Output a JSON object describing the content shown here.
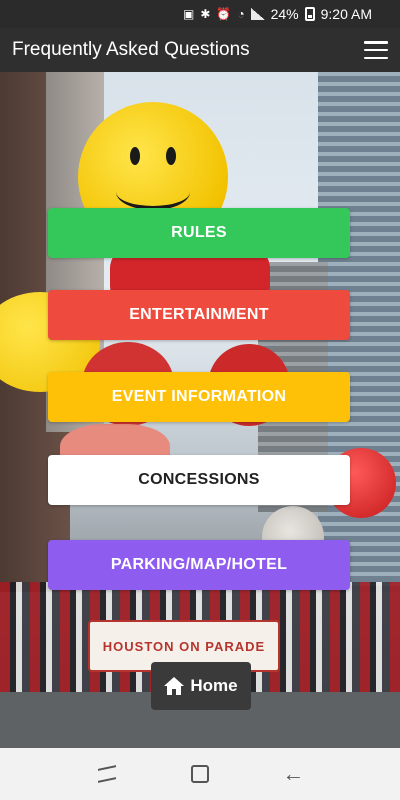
{
  "status_bar": {
    "battery": "24%",
    "time": "9:20 AM",
    "icons": [
      "image-icon",
      "bluetooth-icon",
      "alarm-icon",
      "wifi-icon",
      "signal-icon",
      "battery-icon"
    ]
  },
  "app_bar": {
    "title": "Frequently Asked Questions",
    "menu_icon": "hamburger-menu-icon"
  },
  "hero": {
    "banner_text": "HOUSTON ON PARADE"
  },
  "faq_buttons": [
    {
      "label": "RULES",
      "color": "#34c759"
    },
    {
      "label": "ENTERTAINMENT",
      "color": "#ef4a3e"
    },
    {
      "label": "EVENT INFORMATION",
      "color": "#ffc107"
    },
    {
      "label": "CONCESSIONS",
      "color": "#ffffff"
    },
    {
      "label": "PARKING/MAP/HOTEL",
      "color": "#8e5df0"
    }
  ],
  "home_button": {
    "label": "Home",
    "icon": "home-icon"
  },
  "nav_bar": {
    "icons": [
      "recent-apps-icon",
      "home-nav-icon",
      "back-icon"
    ]
  }
}
